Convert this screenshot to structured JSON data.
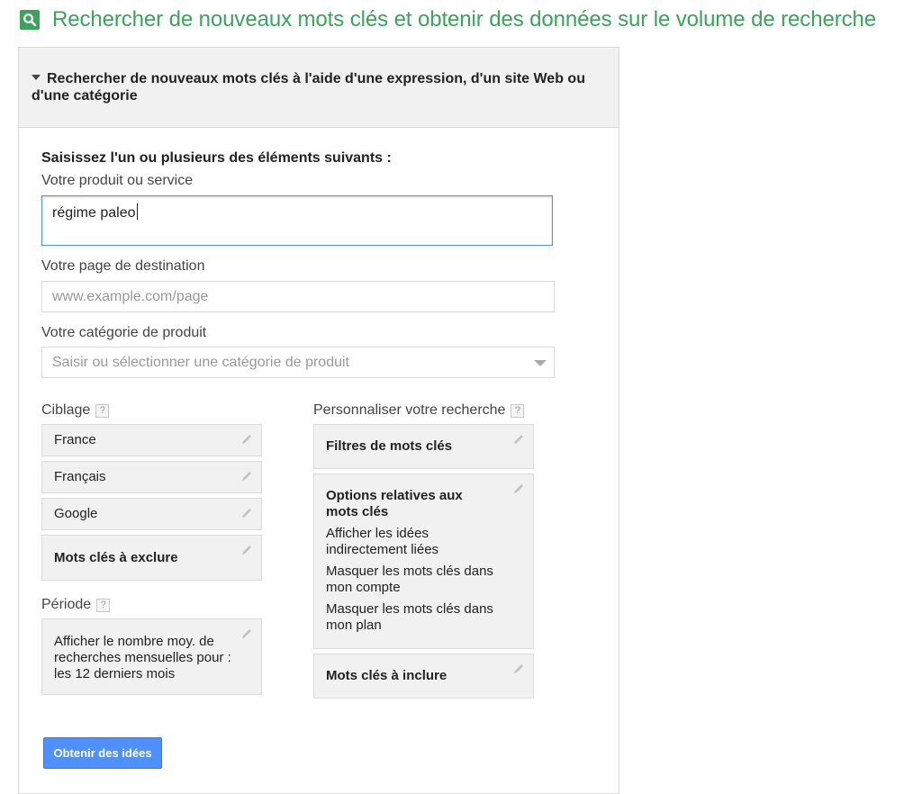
{
  "header": {
    "icon": "search-icon",
    "title": "Rechercher de nouveaux mots clés et obtenir des données sur le volume de recherche"
  },
  "panel": {
    "heading": "Rechercher de nouveaux mots clés à l'aide d'une expression, d'un site Web ou d'une catégorie",
    "intro": "Saisissez l'un ou plusieurs des éléments suivants :"
  },
  "form": {
    "product_label": "Votre produit ou service",
    "product_value": "régime paleo",
    "landing_label": "Votre page de destination",
    "landing_placeholder": "www.example.com/page",
    "category_label": "Votre catégorie de produit",
    "category_placeholder": "Saisir ou sélectionner une catégorie de produit"
  },
  "targeting": {
    "label": "Ciblage",
    "help": "?",
    "items": [
      "France",
      "Français",
      "Google",
      "Mots clés à exclure"
    ]
  },
  "period": {
    "label": "Période",
    "help": "?",
    "text": "Afficher le nombre moy. de recherches mensuelles pour : les 12 derniers mois"
  },
  "customize": {
    "label": "Personnaliser votre recherche",
    "help": "?",
    "filters": "Filtres de mots clés",
    "options_title": "Options relatives aux mots clés",
    "options": [
      "Afficher les idées indirectement liées",
      "Masquer les mots clés dans mon compte",
      "Masquer les mots clés dans mon plan"
    ],
    "include": "Mots clés à inclure"
  },
  "actions": {
    "submit": "Obtenir des idées"
  },
  "colors": {
    "accent_green": "#3aa45a",
    "button_blue": "#4d90fe",
    "tile_bg": "#f1f1f1"
  }
}
